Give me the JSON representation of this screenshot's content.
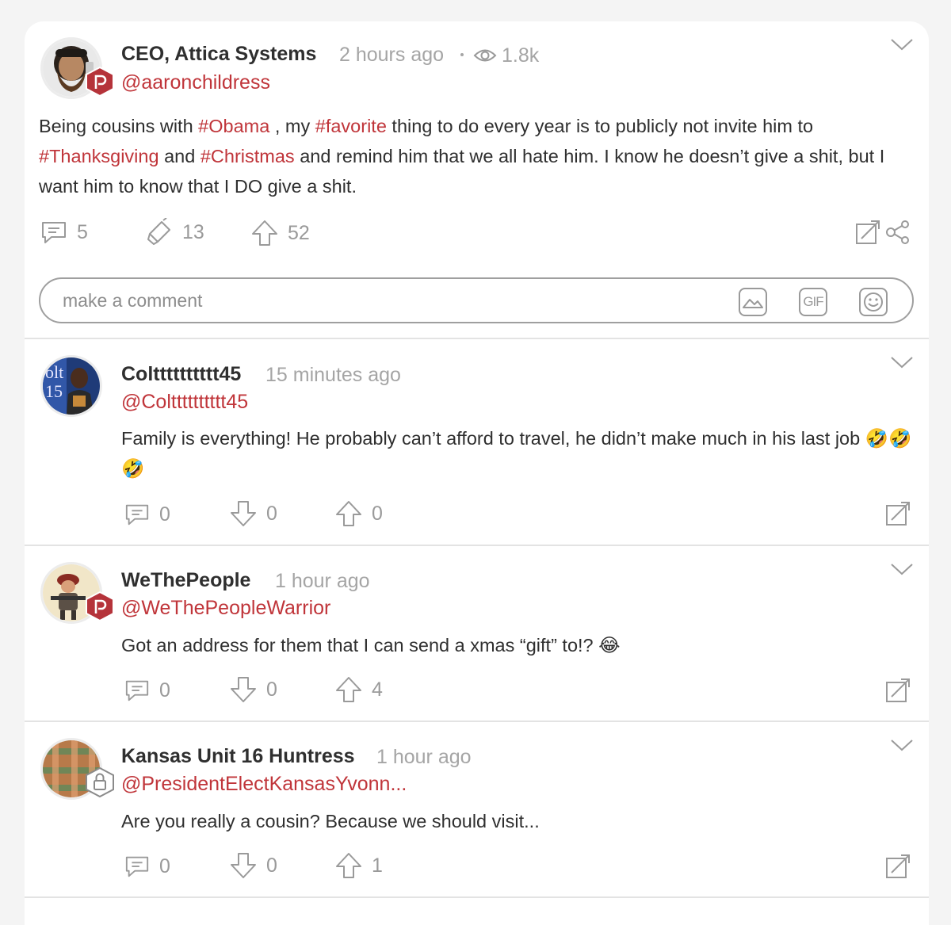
{
  "post": {
    "display_name": "CEO, Attica Systems",
    "time": "2 hours ago",
    "views": "1.8k",
    "handle": "@aaronchildress",
    "body_parts": [
      {
        "t": "Being cousins with ",
        "tag": false
      },
      {
        "t": "#Obama",
        "tag": true
      },
      {
        "t": " , my ",
        "tag": false
      },
      {
        "t": "#favorite",
        "tag": true
      },
      {
        "t": " thing to do every year is to publicly not invite him to ",
        "tag": false
      },
      {
        "t": "#Thanksgiving",
        "tag": true
      },
      {
        "t": " and ",
        "tag": false
      },
      {
        "t": "#Christmas",
        "tag": true
      },
      {
        "t": " and remind him that we all hate him. I know he doesn’t give a shit, but I want him to know that I DO give a shit.",
        "tag": false
      }
    ],
    "comments_count": "5",
    "echoes_count": "13",
    "upvotes_count": "52",
    "comment_placeholder": "make a comment",
    "gif_label": "GIF"
  },
  "replies": [
    {
      "display_name": "Coltttttttttt45",
      "time": "15 minutes ago",
      "handle": "@Coltttttttttt45",
      "text": "Family is everything! He probably can’t afford to travel, he didn’t make much in his last job 🤣🤣🤣",
      "comments": "0",
      "downvotes": "0",
      "upvotes": "0"
    },
    {
      "display_name": "WeThePeople",
      "time": "1 hour ago",
      "handle": "@WeThePeopleWarrior",
      "text": "Got an address for them that I can send a xmas “gift” to!? 😂",
      "comments": "0",
      "downvotes": "0",
      "upvotes": "4"
    },
    {
      "display_name": "Kansas Unit 16 Huntress",
      "time": "1 hour ago",
      "handle": "@PresidentElectKansasYvonn...",
      "text": "Are you really a cousin? Because we should visit...",
      "comments": "0",
      "downvotes": "0",
      "upvotes": "1"
    }
  ],
  "colors": {
    "accent": "#c0353a",
    "muted": "#a5a5a5",
    "background": "#f4f4f4"
  }
}
